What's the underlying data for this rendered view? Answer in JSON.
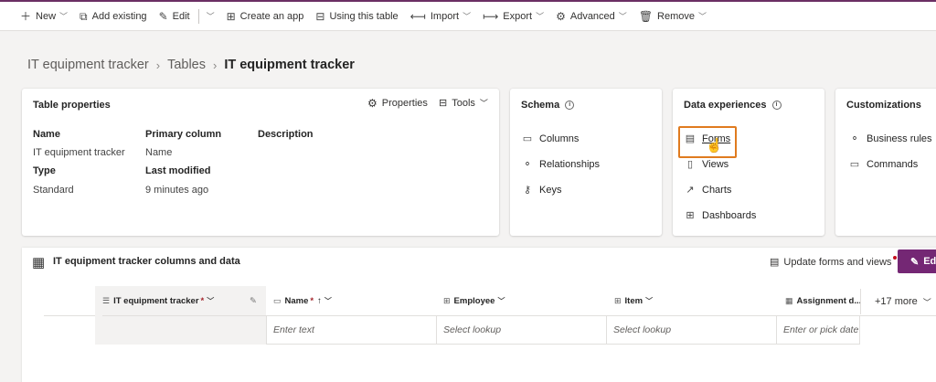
{
  "colors": {
    "accent": "#6b2f64",
    "highlight": "#e07b1f"
  },
  "toolbar": {
    "new": "New",
    "add_existing": "Add existing",
    "edit": "Edit",
    "create_app": "Create an app",
    "using_table": "Using this table",
    "import": "Import",
    "export": "Export",
    "advanced": "Advanced",
    "remove": "Remove"
  },
  "breadcrumb": {
    "root": "IT equipment tracker",
    "tables": "Tables",
    "current": "IT equipment tracker"
  },
  "table_properties": {
    "title": "Table properties",
    "properties_btn": "Properties",
    "tools_btn": "Tools",
    "name_label": "Name",
    "name_value": "IT equipment tracker",
    "primary_label": "Primary column",
    "primary_value": "Name",
    "description_label": "Description",
    "type_label": "Type",
    "type_value": "Standard",
    "modified_label": "Last modified",
    "modified_value": "9 minutes ago"
  },
  "schema": {
    "title": "Schema",
    "items": [
      "Columns",
      "Relationships",
      "Keys"
    ]
  },
  "data_experiences": {
    "title": "Data experiences",
    "items": [
      "Forms",
      "Views",
      "Charts",
      "Dashboards"
    ]
  },
  "customizations": {
    "title": "Customizations",
    "items": [
      "Business rules",
      "Commands"
    ]
  },
  "data_section": {
    "title": "IT equipment tracker columns and data",
    "update_btn": "Update forms and views",
    "edit_btn": "Ed",
    "columns": [
      "IT equipment tracker",
      "Name",
      "Employee",
      "Item",
      "Assignment d..."
    ],
    "more": "+17 more",
    "placeholders": [
      "Enter text",
      "Select lookup",
      "Select lookup",
      "Enter or pick date"
    ]
  }
}
